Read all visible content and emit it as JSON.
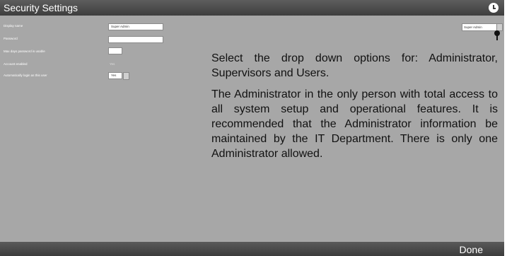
{
  "window": {
    "title": "Security Settings",
    "clock_icon": "clock-icon"
  },
  "form": {
    "display_name_label": "Display name",
    "display_name_value": "Super Admin",
    "password_label": "Password",
    "password_value": "",
    "max_days_label": "Max days password is usable",
    "max_days_value": "",
    "account_enabled_label": "Account enabled",
    "account_enabled_value": "Yes",
    "auto_login_label": "Automatically login as this user",
    "auto_login_value": "Yes"
  },
  "user_select": {
    "value": "Super Admin"
  },
  "instructions": {
    "paragraph1": "Select the drop down options for: Administrator, Supervisors and Users.",
    "paragraph2": "The Administrator in the only person with total access to all system setup and operational features. It is recommended that the Administrator information be maintained by the IT Department. There is only one Administrator allowed."
  },
  "footer": {
    "done_label": "Done"
  }
}
